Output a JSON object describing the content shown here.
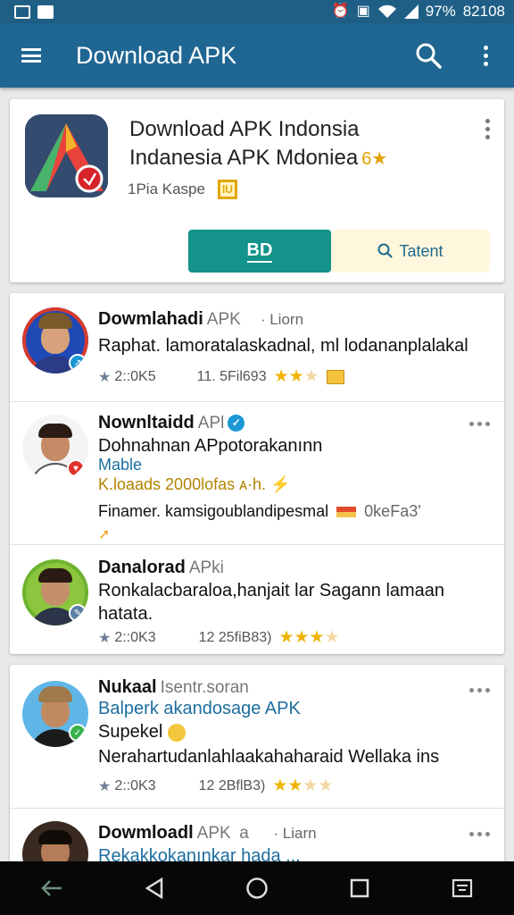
{
  "status_bar": {
    "battery": "97%",
    "time": "82108",
    "left_icons": [
      "image-icon",
      "mail-icon"
    ],
    "right_icons": [
      "alarm-icon",
      "screenshot-icon",
      "wifi-icon",
      "signal-icon"
    ]
  },
  "app_bar": {
    "title": "Download APK",
    "menu_icon": "hamburger-menu-icon",
    "actions": [
      "search-icon",
      "overflow-menu-icon"
    ],
    "color": "#1f6692"
  },
  "app_card": {
    "title": "Download APK Indonsia",
    "subtitle": "Indanesia APK Mdoniea",
    "rating": "6★",
    "meta": "1Pia Kaspe",
    "meta_badge": "lU",
    "primary_button": "BD",
    "secondary_button": "Tatent",
    "accent": "#13938a"
  },
  "posts": [
    {
      "name": "Dowmlahadi",
      "name_suffix": "APK",
      "extra": "Liorn",
      "text_lines": [
        "Raphat. lamoratalaskadnal, ml lodananplalakal"
      ],
      "stats_left": "2::0K5",
      "stats_mid": "11. 5Fil693"
    },
    {
      "name": "Nownltaidd",
      "name_suffix": "APl",
      "text_lines": [
        "Dohnahnan APpotorakanınn",
        "Mable",
        "K.loaads 2000lofas ᴀ·h. ⚡",
        "Finamer. kamsigoublandipesmal",
        "0keFa3'"
      ],
      "stats_left": "",
      "stats_mid": ""
    },
    {
      "name": "Danalorad",
      "name_suffix": "APki",
      "text_lines": [
        "Ronkalacbaraloa,hanjait lar Sagann lamaan",
        "hatata."
      ],
      "stats_left": "2::0K3",
      "stats_mid": "12 25fiB83)"
    },
    {
      "name": "Nukaal",
      "name_suffix": "Isentr.soran",
      "text_lines": [
        "Balperk akandosage APK",
        "Supekel",
        "Nerahartudanlahlaakahaharaid Wellaka ins"
      ],
      "stats_left": "2::0K3",
      "stats_mid": "12 2BflB3)"
    },
    {
      "name": "Dowmloadl",
      "name_suffix": "APK",
      "name_mark": "a",
      "extra": "Liarn",
      "text_lines": [
        "Rekakkokanınkar hada ..."
      ]
    }
  ],
  "nav_bar": [
    "back-arrow-icon",
    "back-triangle-icon",
    "home-circle-icon",
    "recents-square-icon",
    "keyboard-icon"
  ]
}
